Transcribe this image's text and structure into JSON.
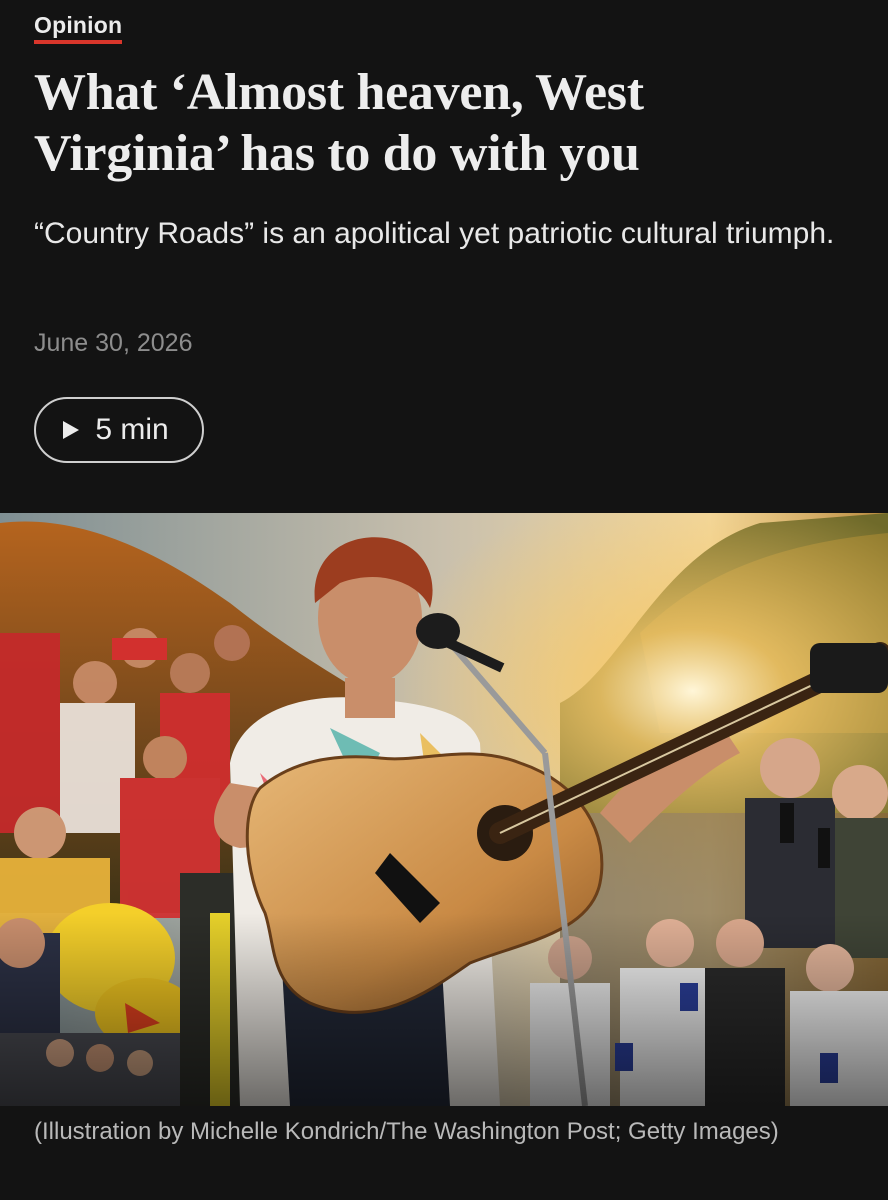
{
  "article": {
    "section": "Opinion",
    "headline": "What ‘Almost heaven, West Virginia’ has to do with you",
    "dek": "“Country Roads” is an apolitical yet patriotic cultural triumph.",
    "date": "June 30, 2026",
    "listen": {
      "label": "5 min",
      "icon": "play-icon"
    },
    "image": {
      "description_icon": "illustration-image"
    },
    "caption": "(Illustration by Michelle Kondrich/The Washington Post; Getty Images)"
  },
  "colors": {
    "background": "#131313",
    "text": "#ececec",
    "muted": "#8d8d8d",
    "section_underline": "#d9362b"
  }
}
